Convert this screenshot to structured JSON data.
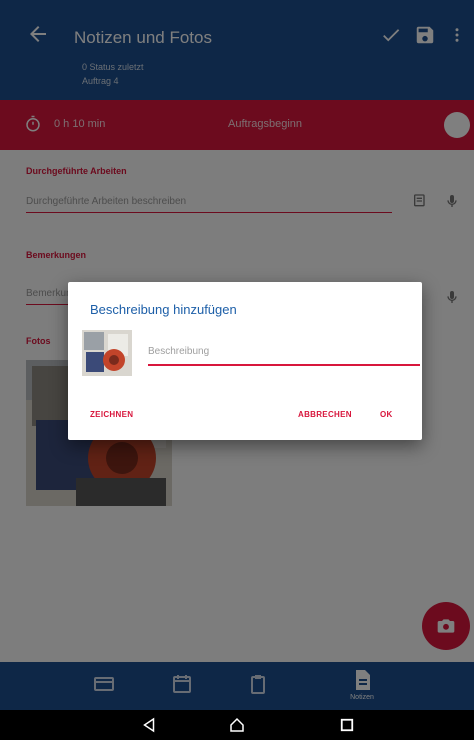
{
  "appbar": {
    "title": "Notizen und Fotos",
    "subtitle_line1": "0 Status zuletzt",
    "subtitle_line2": "Auftrag 4",
    "back_icon": "arrow-left-icon",
    "actions": [
      "check-icon",
      "save-icon",
      "more-vert-icon"
    ]
  },
  "statusbar": {
    "time": "0 h  10 min",
    "status": "Auftragsbeginn",
    "color": "#d8163c"
  },
  "content": {
    "section1_label": "Durchgeführte Arbeiten",
    "section1_placeholder": "Durchgeführte Arbeiten beschreiben",
    "section2_label": "Bemerkungen",
    "section2_placeholder": "Bemerkung",
    "photos_label": "Fotos"
  },
  "dialog": {
    "title": "Beschreibung hinzufügen",
    "input_value": "",
    "input_placeholder": "Beschreibung",
    "draw_label": "ZEICHNEN",
    "cancel_label": "ABBRECHEN",
    "ok_label": "OK"
  },
  "bottomnav": {
    "active_label": "Notizen",
    "items": [
      "card-icon",
      "calendar-icon",
      "clipboard-icon",
      "notes-icon"
    ]
  },
  "colors": {
    "primary": "#1d4f8e",
    "accent": "#d8163c"
  }
}
